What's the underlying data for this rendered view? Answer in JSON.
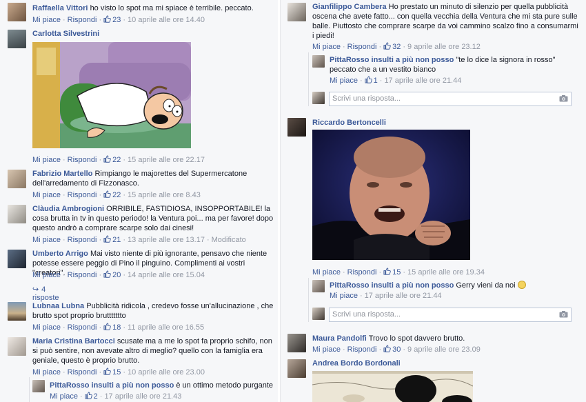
{
  "common": {
    "like": "Mi piace",
    "reply": "Rispondi",
    "dot": "·",
    "edited": "Modificato",
    "reply_placeholder": "Scrivi una risposta..."
  },
  "left": {
    "c1": {
      "name": "Raffaella Vittori",
      "text": "ho visto lo spot ma mi spiace è terribile. peccato.",
      "likes": "23",
      "time": "10 aprile alle ore 14.40"
    },
    "c2": {
      "name": "Carlotta Silvestrini",
      "likes": "22",
      "time": "15 aprile alle ore 22.17"
    },
    "c3": {
      "name": "Fabrizio Martello",
      "text": "Rimpiango le majorettes del Supermercatone dell'arredamento di Fizzonasco.",
      "likes": "22",
      "time": "15 aprile alle ore 8.43"
    },
    "c4": {
      "name": "Clàudia Ambrogioni",
      "text": "ORRIBILE, FASTIDIOSA, INSOPPORTABILE! la cosa brutta in tv in questo periodo! la Ventura poi... ma per favore! dopo questo andrò a comprare scarpe solo dai cinesi!",
      "likes": "21",
      "time": "13 aprile alle ore 13.17"
    },
    "c5": {
      "name": "Umberto Arrigo",
      "text": "Mai visto niente di più ignorante, pensavo che niente potesse essere peggio di Pino il pinguino. Complimenti ai vostri \"creatori\".",
      "likes": "20",
      "time": "14 aprile alle ore 15.04",
      "replies": "4 risposte"
    },
    "c6": {
      "name": "Lubnaa Lubna",
      "text": "Pubblicità ridicola , credevo fosse un'allucinazione , che brutto spot proprio bruttttttto",
      "likes": "18",
      "time": "11 aprile alle ore 16.55"
    },
    "c7": {
      "name": "Maria Cristina Bartocci",
      "text": "scusate ma a me lo spot fa proprio schifo, non si può sentire, non avevate altro di meglio? quello con la famiglia era geniale, questo è proprio brutto.",
      "likes": "15",
      "time": "10 aprile alle ore 23.00"
    },
    "r7": {
      "name": "PittaRosso insulti a più non posso",
      "text": "è un ottimo metodo purgante",
      "likes": "2",
      "time": "17 aprile alle ore 21.43"
    }
  },
  "right": {
    "c1": {
      "name": "Gianfilippo Cambera",
      "text": "Ho prestato un minuto di silenzio per quella pubblicità oscena che avete fatto... con quella vecchia della Ventura che mi sta pure sulle balle. Piuttosto che comprare scarpe da voi cammino scalzo fino a consumarmi i piedi!",
      "likes": "32",
      "time": "9 aprile alle ore 23.12"
    },
    "r1": {
      "name": "PittaRosso insulti a più non posso",
      "text": "\"te lo dice la signora in rosso\" peccato che a un vestito bianco",
      "likes": "1",
      "time": "17 aprile alle ore 21.44"
    },
    "c2": {
      "name": "Riccardo Bertoncelli",
      "likes": "15",
      "time": "15 aprile alle ore 19.34"
    },
    "r2": {
      "name": "PittaRosso insulti a più non posso",
      "text": "Gerry vieni da noi",
      "time": "17 aprile alle ore 21.44"
    },
    "c3": {
      "name": "Maura Pandolfi",
      "text": "Trovo lo spot davvero brutto.",
      "likes": "30",
      "time": "9 aprile alle ore 23.09"
    },
    "c4": {
      "name": "Andrea Bordo Bordonali"
    }
  }
}
